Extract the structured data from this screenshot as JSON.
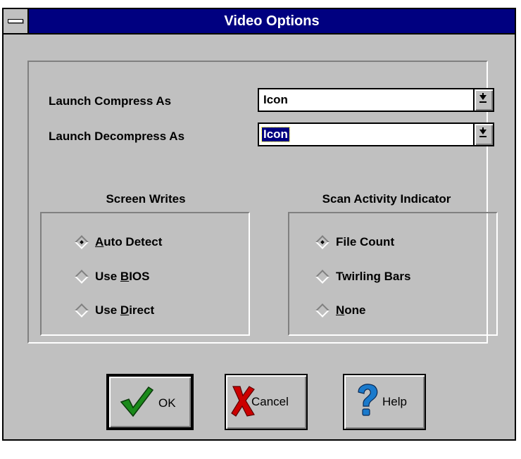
{
  "window": {
    "title": "Video Options"
  },
  "launch": {
    "compress_label": "Launch Compress As",
    "compress_value": "Icon",
    "decompress_label": "Launch Decompress As",
    "decompress_value": "Icon"
  },
  "screen_writes": {
    "title": "Screen Writes",
    "options": [
      {
        "pre": "",
        "u": "A",
        "post": "uto Detect",
        "selected": true
      },
      {
        "pre": "Use ",
        "u": "B",
        "post": "IOS",
        "selected": false
      },
      {
        "pre": "Use ",
        "u": "D",
        "post": "irect",
        "selected": false
      }
    ]
  },
  "scan_indicator": {
    "title": "Scan Activity Indicator",
    "options": [
      {
        "pre": "File Count",
        "u": "",
        "post": "",
        "selected": true
      },
      {
        "pre": "Twirling Bars",
        "u": "",
        "post": "",
        "selected": false
      },
      {
        "pre": "",
        "u": "N",
        "post": "one",
        "selected": false
      }
    ]
  },
  "buttons": {
    "ok": "OK",
    "cancel": "Cancel",
    "help": "Help"
  },
  "colors": {
    "titlebar": "#000080",
    "face": "#c0c0c0",
    "ok_check": "#1a8a1a",
    "cancel_x": "#cc0000",
    "help_q": "#1a7acc"
  }
}
